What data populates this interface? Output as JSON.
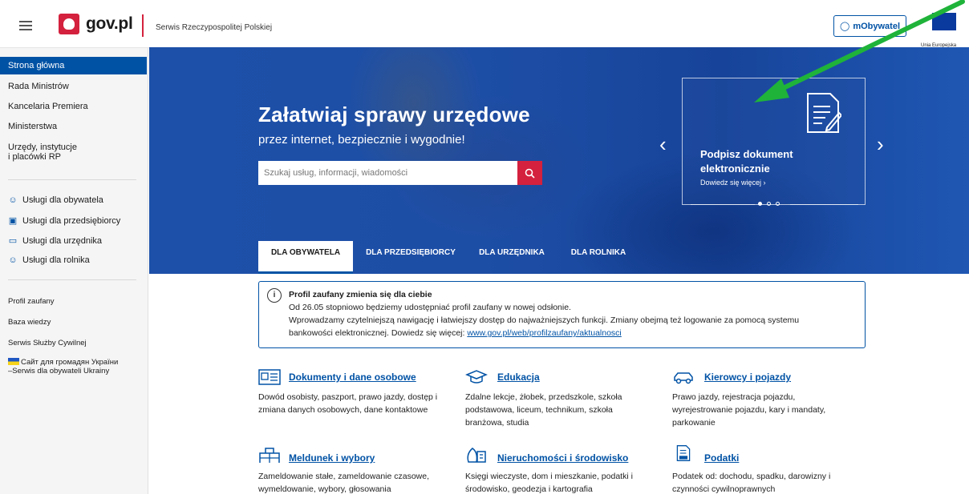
{
  "header": {
    "logo_text": "gov.pl",
    "service_name": "Serwis Rzeczypospolitej Polskiej",
    "mobywatel_label": "mObywatel",
    "eu_label": "Unia Europejska"
  },
  "sidebar": {
    "nav": [
      "Strona główna",
      "Rada Ministrów",
      "Kancelaria Premiera",
      "Ministerstwa",
      "Urzędy, instytucje",
      "i placówki RP"
    ],
    "services": [
      "Usługi dla obywatela",
      "Usługi dla przedsiębiorcy",
      "Usługi dla urzędnika",
      "Usługi dla rolnika"
    ],
    "links": [
      "Profil zaufany",
      "Baza wiedzy",
      "Serwis Służby Cywilnej",
      "Сайт для громадян України",
      "–Serwis dla obywateli Ukrainy"
    ]
  },
  "hero": {
    "title": "Załatwiaj sprawy urzędowe",
    "subtitle": "przez internet, bezpiecznie i wygodnie!",
    "search_placeholder": "Szukaj usług, informacji, wiadomości",
    "card_title": "Podpisz dokument elektronicznie",
    "card_link": "Dowiedz się więcej ›",
    "arrow_prev": "‹",
    "arrow_next": "›"
  },
  "tabs": [
    "DLA OBYWATELA",
    "DLA PRZEDSIĘBIORCY",
    "DLA URZĘDNIKA",
    "DLA ROLNIKA"
  ],
  "notice": {
    "icon": "i",
    "title": "Profil zaufany zmienia się dla ciebie",
    "line1": "Od 26.05 stopniowo będziemy udostępniać profil zaufany w nowej odsłonie.",
    "line2": "Wprowadzamy czytelniejszą nawigację i łatwiejszy dostęp do najważniejszych funkcji. Zmiany obejmą też logowanie za pomocą systemu",
    "line3_prefix": "bankowości elektronicznej. Dowiedz się więcej: ",
    "line3_link": "www.gov.pl/web/profilzaufany/aktualnosci"
  },
  "categories": [
    {
      "title": "Dokumenty i dane osobowe",
      "desc1": "Dowód osobisty, paszport, prawo jazdy, dostęp i",
      "desc2": "zmiana danych osobowych, dane kontaktowe",
      "desc3": ""
    },
    {
      "title": "Edukacja",
      "desc1": "Zdalne lekcje, żłobek, przedszkole, szkoła",
      "desc2": "podstawowa, liceum, technikum, szkoła",
      "desc3": "branżowa, studia"
    },
    {
      "title": "Kierowcy i pojazdy",
      "desc1": "Prawo jazdy, rejestracja pojazdu,",
      "desc2": "wyrejestrowanie pojazdu, kary i mandaty,",
      "desc3": "parkowanie"
    },
    {
      "title": "Meldunek i wybory",
      "desc1": "Zameldowanie stałe, zameldowanie czasowe,",
      "desc2": "wymeldowanie, wybory, głosowania",
      "desc3": ""
    },
    {
      "title": "Nieruchomości i środowisko",
      "desc1": "Księgi wieczyste, dom i mieszkanie, podatki i",
      "desc2": "środowisko, geodezja i kartografia",
      "desc3": ""
    },
    {
      "title": "Podatki",
      "desc1": "Podatek od: dochodu, spadku, darowizny i",
      "desc2": "czynności cywilnoprawnych",
      "desc3": ""
    }
  ],
  "colors": {
    "brand_blue": "#0052a5",
    "brand_red": "#d4213d",
    "annotation_green": "#1fb33a"
  }
}
